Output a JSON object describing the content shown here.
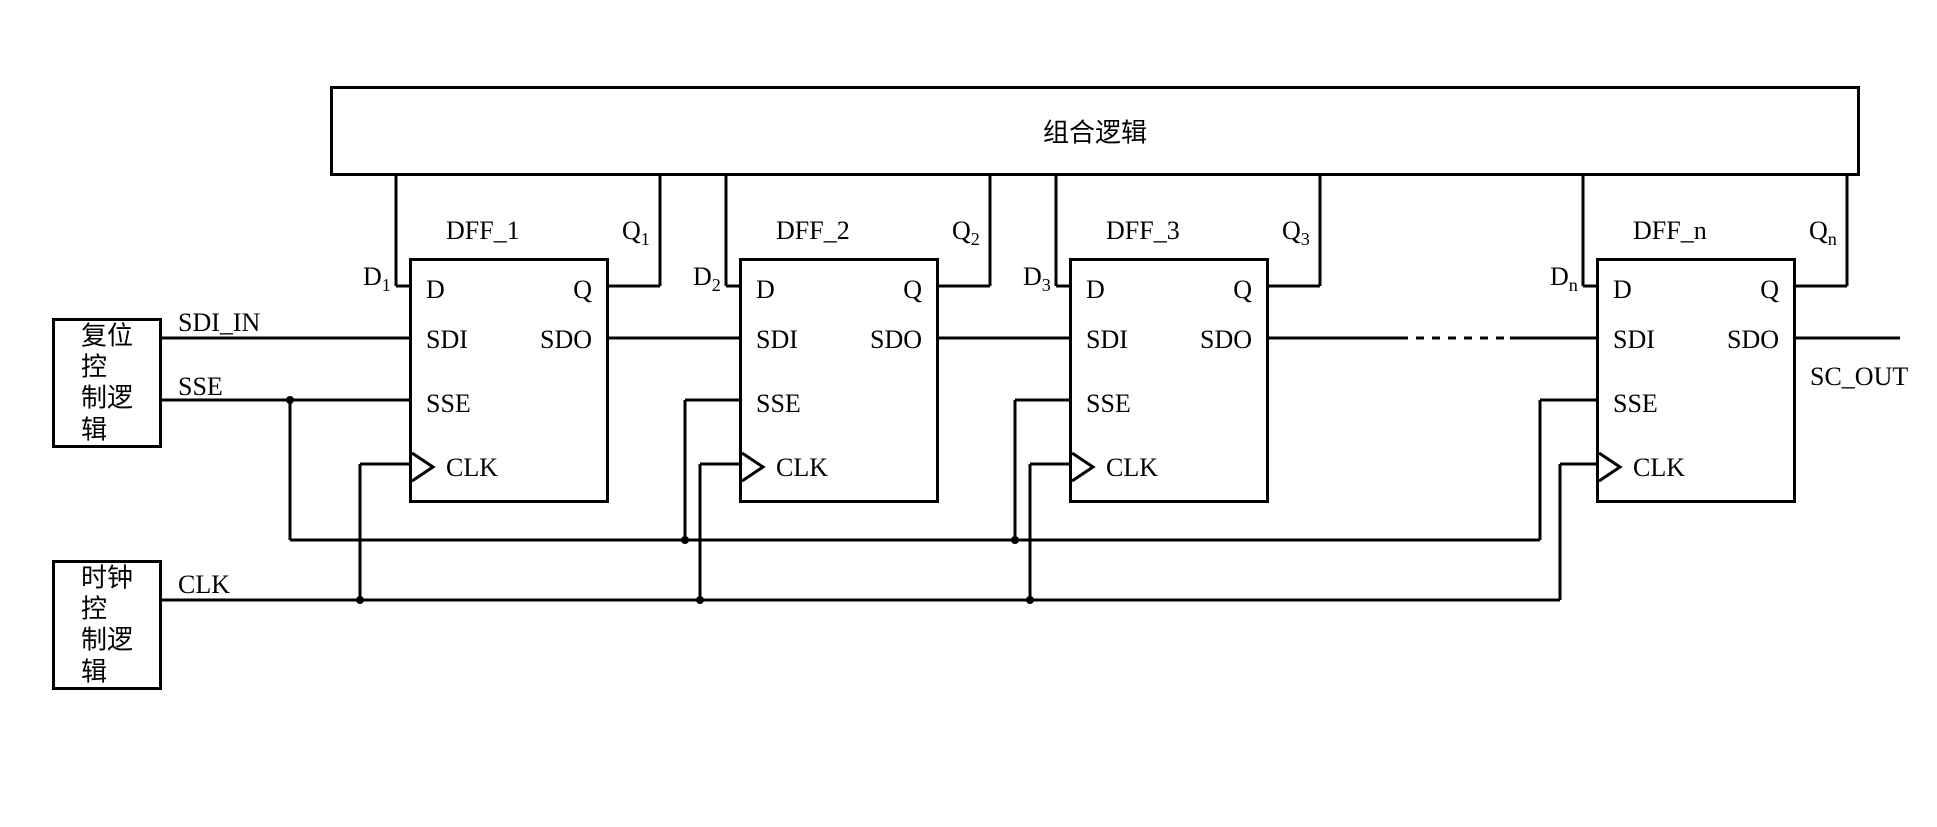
{
  "top_block": "组合逻辑",
  "reset_block_l1": "复位控",
  "reset_block_l2": "制逻辑",
  "clock_block_l1": "时钟控",
  "clock_block_l2": "制逻辑",
  "sig_sdi_in": "SDI_IN",
  "sig_sse": "SSE",
  "sig_clk": "CLK",
  "sig_sc_out": "SC_OUT",
  "dff1_title": "DFF_1",
  "dff2_title": "DFF_2",
  "dff3_title": "DFF_3",
  "dffn_title": "DFF_n",
  "d1": "D",
  "q1": "Q",
  "dext1": "D₁",
  "qext1": "Q₁",
  "dext2": "D₂",
  "qext2": "Q₂",
  "dext3": "D₃",
  "qext3": "Q₃",
  "dextn": "Dₙ",
  "qextn": "Qₙ",
  "pin_d": "D",
  "pin_q": "Q",
  "pin_sdi": "SDI",
  "pin_sdo": "SDO",
  "pin_sse": "SSE",
  "pin_clk": "CLK"
}
